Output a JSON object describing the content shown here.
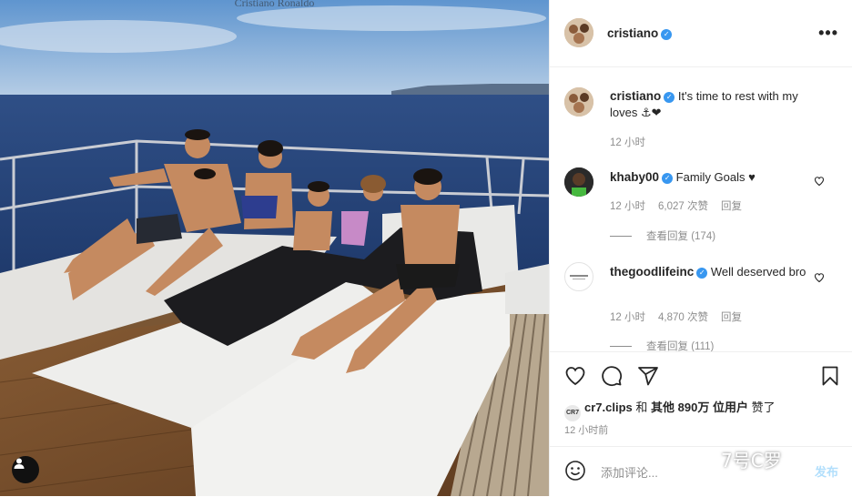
{
  "photo": {
    "top_watermark": "Cristiano Ronaldo",
    "tag_icon": "user-tag-icon"
  },
  "post": {
    "author": "cristiano",
    "verified_icon": "verified-badge-icon",
    "more_icon": "more-horizontal-icon",
    "more_label": "•••"
  },
  "comments": [
    {
      "username": "cristiano",
      "text": "It's time to rest with my loves ⚓❤",
      "time": "12 小时",
      "likes": "",
      "reply": ""
    },
    {
      "username": "khaby00",
      "text": "Family Goals ♥",
      "time": "12 小时",
      "likes": "6,027 次赞",
      "reply": "回复",
      "view_replies": "查看回复 (174)"
    },
    {
      "username": "thegoodlifeinc",
      "text": "Well deserved bro",
      "time": "12 小时",
      "likes": "4,870 次赞",
      "reply": "回复",
      "view_replies": "查看回复 (111)"
    }
  ],
  "actions": {
    "icons": [
      "heart-icon",
      "comment-icon",
      "share-icon",
      "bookmark-icon"
    ]
  },
  "likes": {
    "badge": "CR7",
    "account": "cr7.clips",
    "conjunction": "和",
    "others": "其他 890万 位用户",
    "suffix": "赞了"
  },
  "time_ago": "12 小时前",
  "compose": {
    "emoji_icon": "emoji-icon",
    "placeholder": "添加评论...",
    "post_label": "发布"
  },
  "overlay_watermark": "7号C罗",
  "colors": {
    "accent": "#3897f0",
    "post_disabled": "#b2dffc",
    "secondary_text": "#8e8e8e"
  }
}
